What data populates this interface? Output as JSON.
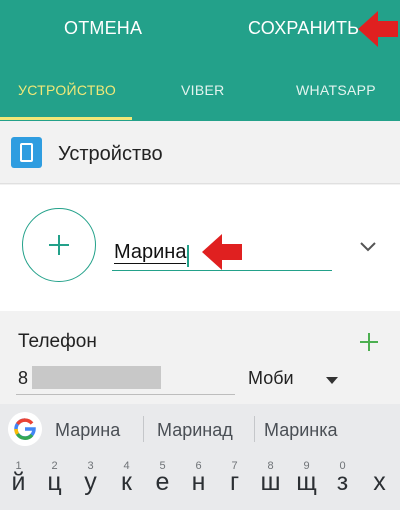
{
  "header": {
    "cancel_label": "ОТМЕНА",
    "save_label": "СОХРАНИТЬ"
  },
  "tabs": [
    {
      "label": "УСТРОЙСТВО",
      "selected": true
    },
    {
      "label": "VIBER",
      "selected": false
    },
    {
      "label": "WHATSAPP",
      "selected": false
    }
  ],
  "account": {
    "label": "Устройство",
    "icon": "phone-device-icon"
  },
  "contact": {
    "name_value": "Марина",
    "add_photo_icon": "plus-icon",
    "expand_icon": "chevron-down-icon"
  },
  "phone": {
    "label": "Телефон",
    "value_visible": "8",
    "type_value": "Моби",
    "add_icon": "plus-icon"
  },
  "keyboard": {
    "suggestions": [
      "Марина",
      "Маринад",
      "Маринка"
    ],
    "keys": [
      {
        "num": "1",
        "char": "й"
      },
      {
        "num": "2",
        "char": "ц"
      },
      {
        "num": "3",
        "char": "у"
      },
      {
        "num": "4",
        "char": "к"
      },
      {
        "num": "5",
        "char": "е"
      },
      {
        "num": "6",
        "char": "н"
      },
      {
        "num": "7",
        "char": "г"
      },
      {
        "num": "8",
        "char": "ш"
      },
      {
        "num": "9",
        "char": "щ"
      },
      {
        "num": "0",
        "char": "з"
      },
      {
        "num": "",
        "char": "х"
      }
    ]
  },
  "colors": {
    "accent": "#23a18a",
    "tab_selected": "#f1e878",
    "annotation_arrow": "#e02020",
    "add_phone": "#4caf50"
  }
}
